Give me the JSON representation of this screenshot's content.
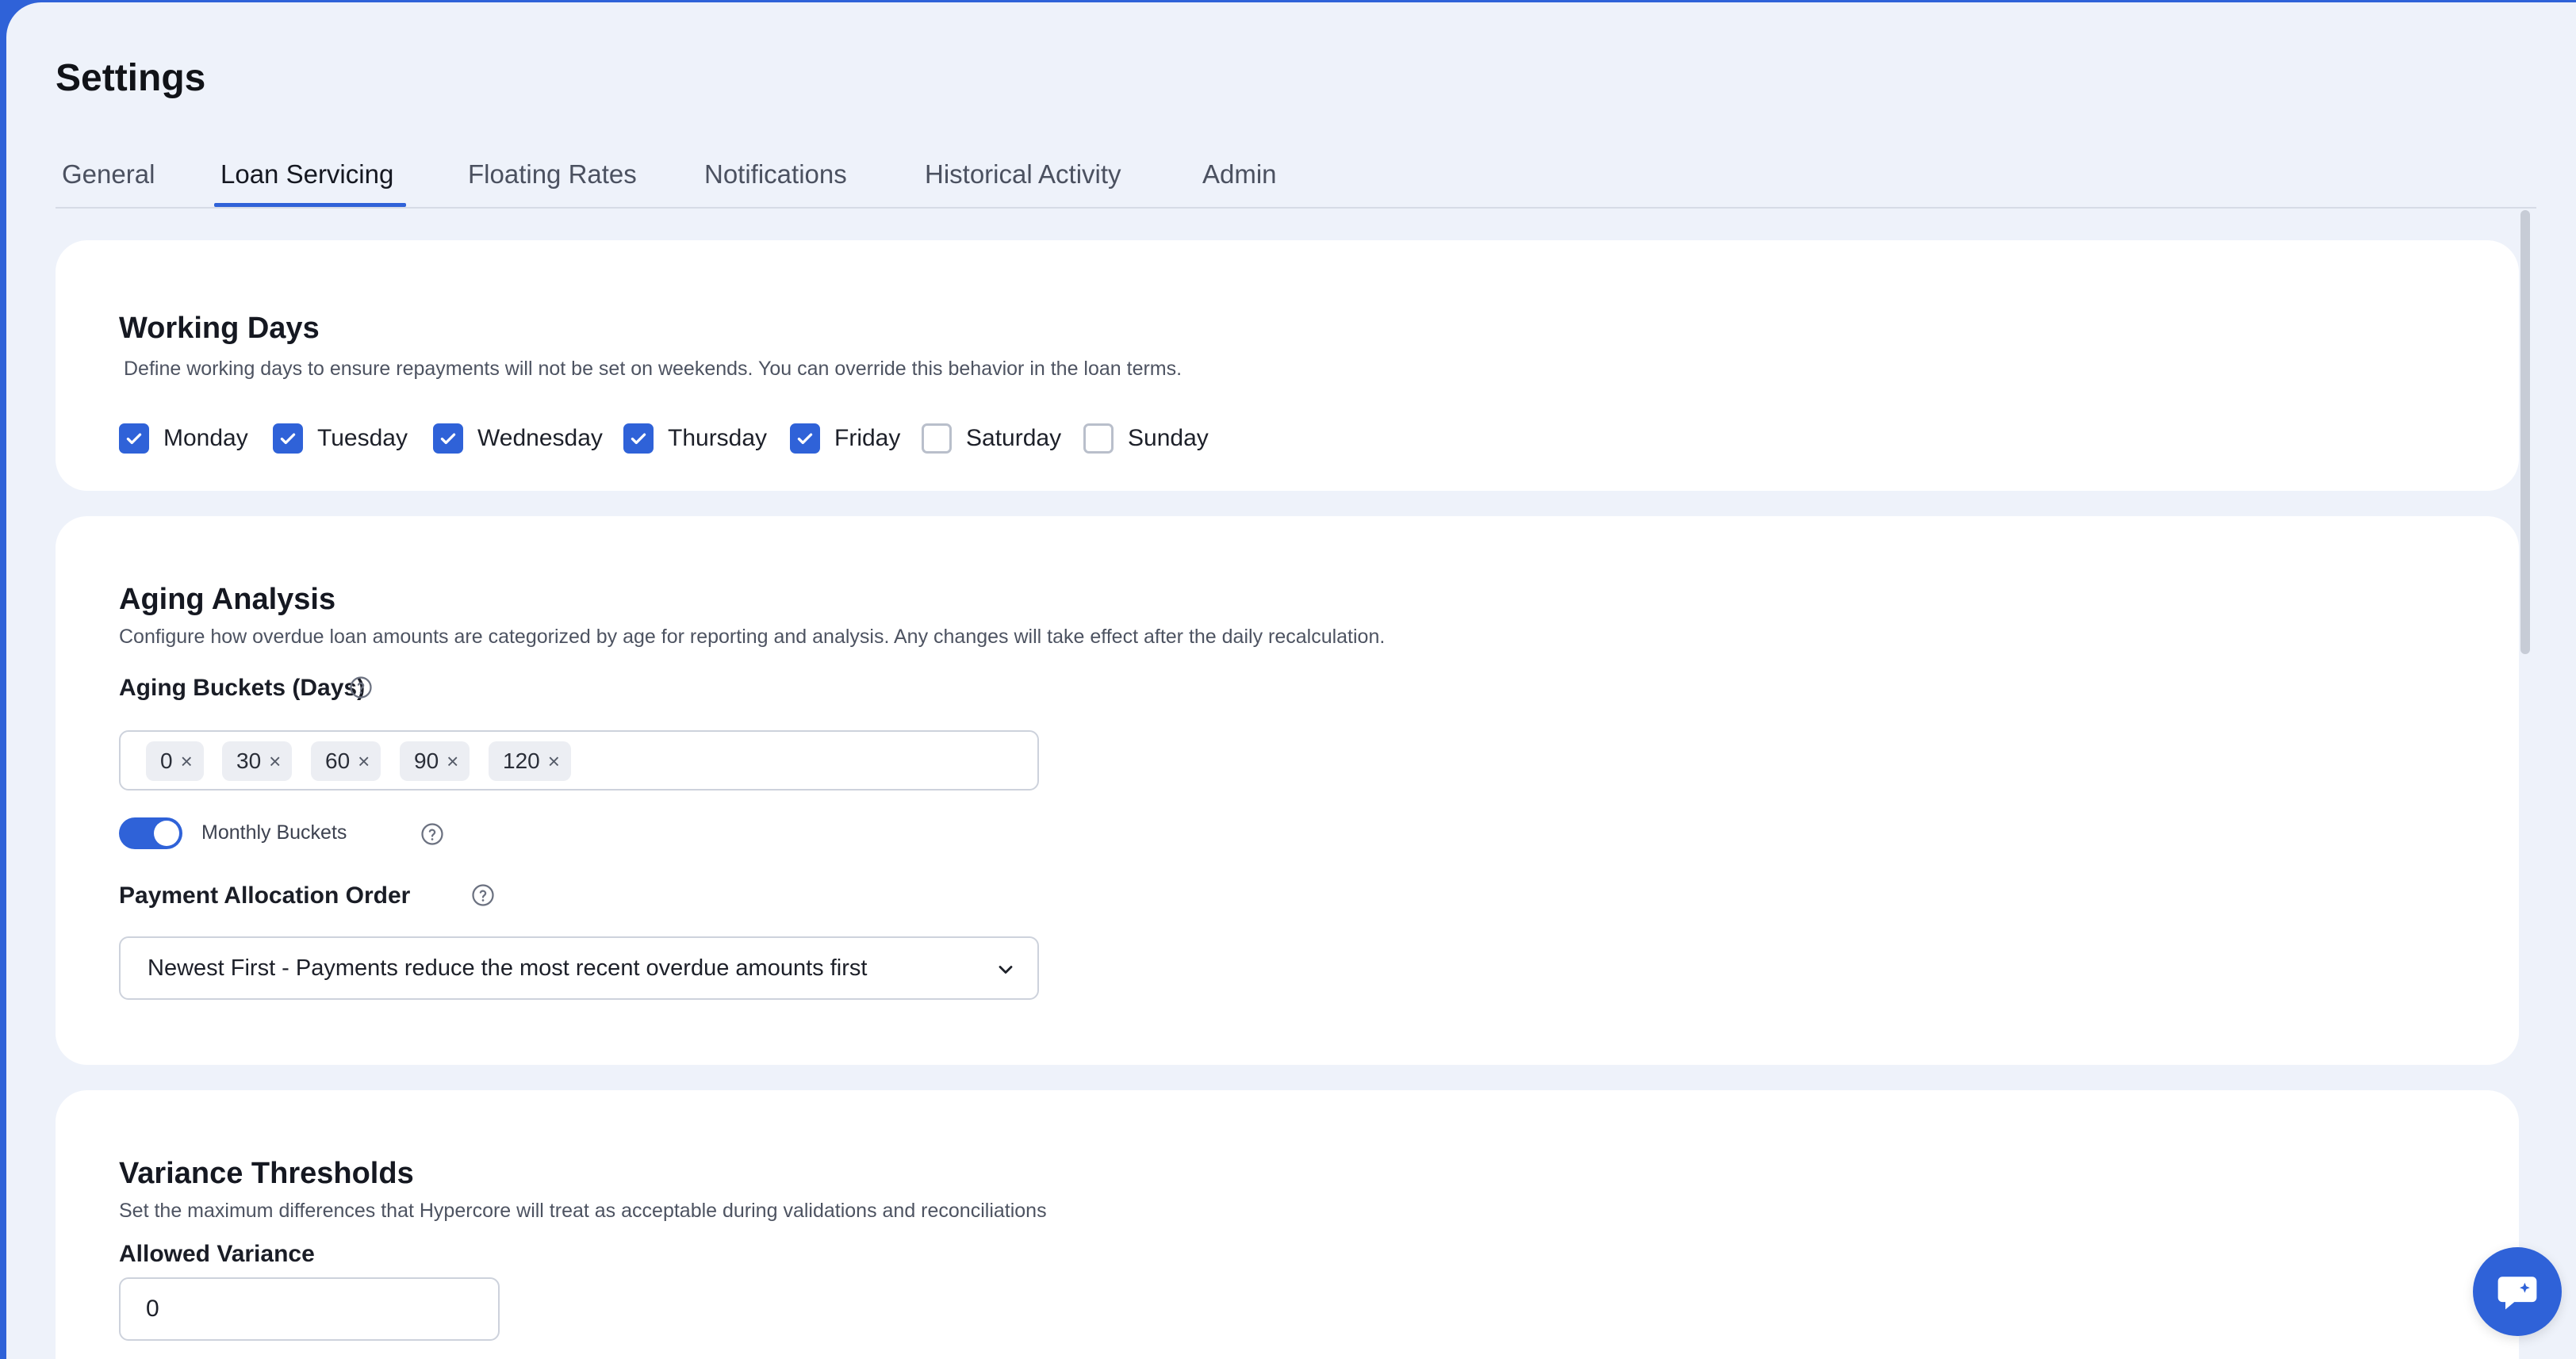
{
  "page": {
    "title": "Settings"
  },
  "tabs": [
    {
      "label": "General",
      "active": false
    },
    {
      "label": "Loan Servicing",
      "active": true
    },
    {
      "label": "Floating Rates",
      "active": false
    },
    {
      "label": "Notifications",
      "active": false
    },
    {
      "label": "Historical Activity",
      "active": false
    },
    {
      "label": "Admin",
      "active": false
    }
  ],
  "working_days": {
    "title": "Working Days",
    "description": "Define working days to ensure repayments will not be set on weekends. You can override this behavior in the loan terms.",
    "days": [
      {
        "label": "Monday",
        "checked": true
      },
      {
        "label": "Tuesday",
        "checked": true
      },
      {
        "label": "Wednesday",
        "checked": true
      },
      {
        "label": "Thursday",
        "checked": true
      },
      {
        "label": "Friday",
        "checked": true
      },
      {
        "label": "Saturday",
        "checked": false
      },
      {
        "label": "Sunday",
        "checked": false
      }
    ]
  },
  "aging_analysis": {
    "title": "Aging Analysis",
    "description": "Configure how overdue loan amounts are categorized by age for reporting and analysis. Any changes will take effect after the daily recalculation.",
    "buckets_label": "Aging Buckets (Days)",
    "buckets": [
      "0",
      "30",
      "60",
      "90",
      "120"
    ],
    "chip_remove_glyph": "×",
    "monthly_buckets": {
      "label": "Monthly Buckets",
      "enabled": true
    },
    "allocation_label": "Payment Allocation Order",
    "allocation_value": "Newest First - Payments reduce the most recent overdue amounts first"
  },
  "variance_thresholds": {
    "title": "Variance Thresholds",
    "description": "Set the maximum differences that Hypercore will treat as acceptable during validations and reconciliations",
    "allowed_variance_label": "Allowed Variance",
    "allowed_variance_value": "0"
  },
  "colors": {
    "accent": "#2f62d8",
    "background": "#eef2fa",
    "card": "#ffffff"
  },
  "icons": {
    "check": "check-icon",
    "help": "help-circle-icon",
    "chevron": "chevron-down-icon",
    "chat": "chat-icon"
  }
}
